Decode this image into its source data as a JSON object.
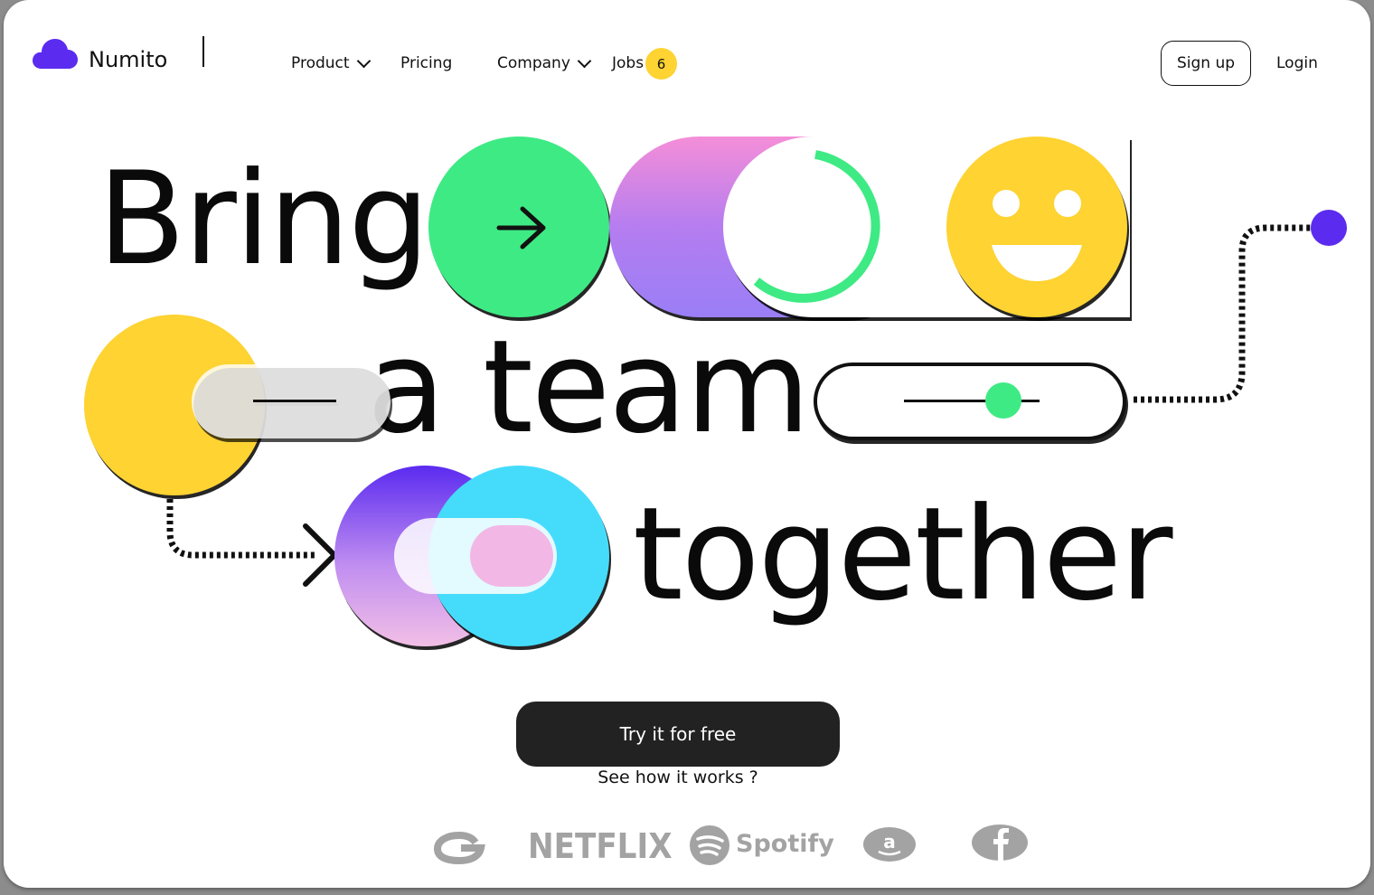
{
  "brand": {
    "name": "Numito",
    "color": "#5b2bf0"
  },
  "nav": {
    "product": "Product",
    "pricing": "Pricing",
    "company": "Company",
    "jobs": "Jobs",
    "jobs_count": "6"
  },
  "auth": {
    "signup": "Sign up",
    "login": "Login"
  },
  "hero": {
    "word1": "Bring",
    "word2": "a team",
    "word3": "together"
  },
  "cta": {
    "primary": "Try it for free",
    "secondary": "See how it works ?"
  },
  "logos": {
    "netflix": "NETFLIX",
    "spotify": "Spotify"
  },
  "colors": {
    "green": "#3eea84",
    "yellow": "#fed332",
    "purple": "#5b2bf0",
    "cyan": "#45dcfc",
    "pink": "#f3b7e6",
    "dark": "#222222"
  },
  "icons": [
    "cloud-icon",
    "arrow-right-icon",
    "smiley-icon",
    "chevron-right-icon",
    "google-icon",
    "spotify-icon",
    "amazon-icon",
    "facebook-icon"
  ]
}
